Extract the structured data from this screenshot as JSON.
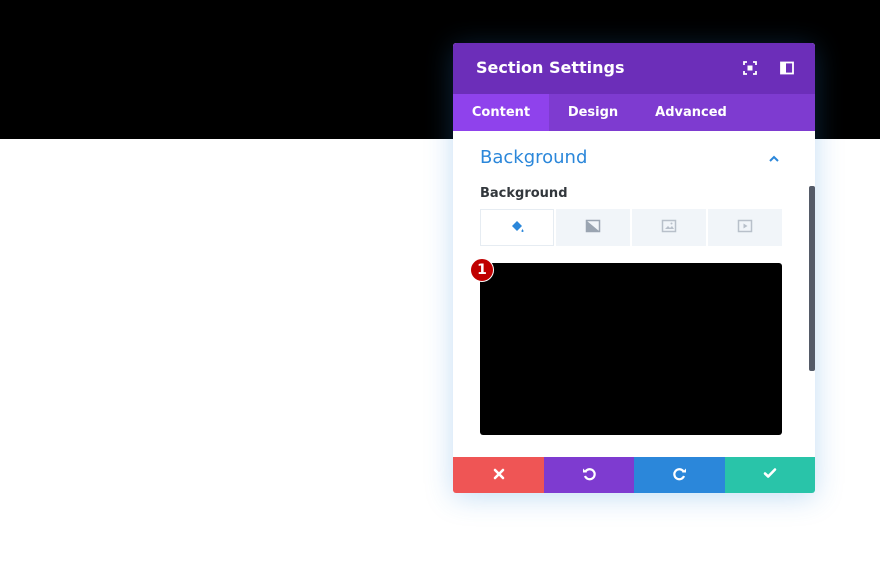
{
  "modal": {
    "title": "Section Settings",
    "header_icons": [
      "focus-mode-icon",
      "sidebar-toggle-icon"
    ]
  },
  "tabs": [
    {
      "label": "Content",
      "active": true
    },
    {
      "label": "Design",
      "active": false
    },
    {
      "label": "Advanced",
      "active": false
    }
  ],
  "section": {
    "title": "Background",
    "expanded": true,
    "field_label": "Background",
    "background_types": [
      "color-fill-icon",
      "gradient-icon",
      "image-icon",
      "video-icon"
    ],
    "selected_type": "color-fill-icon",
    "preview_color": "#000000",
    "badge": "1"
  },
  "footer": {
    "buttons": [
      "close-icon",
      "undo-icon",
      "redo-icon",
      "save-check-icon"
    ],
    "colors": [
      "#ef5555",
      "#7e3bd0",
      "#2b87da",
      "#29c4a9"
    ]
  },
  "colors": {
    "header": "#6c2eb9",
    "tabs": "#7e3bd0",
    "active_tab": "#8f42ec",
    "accent": "#2b87da",
    "top_band": "#000000"
  }
}
